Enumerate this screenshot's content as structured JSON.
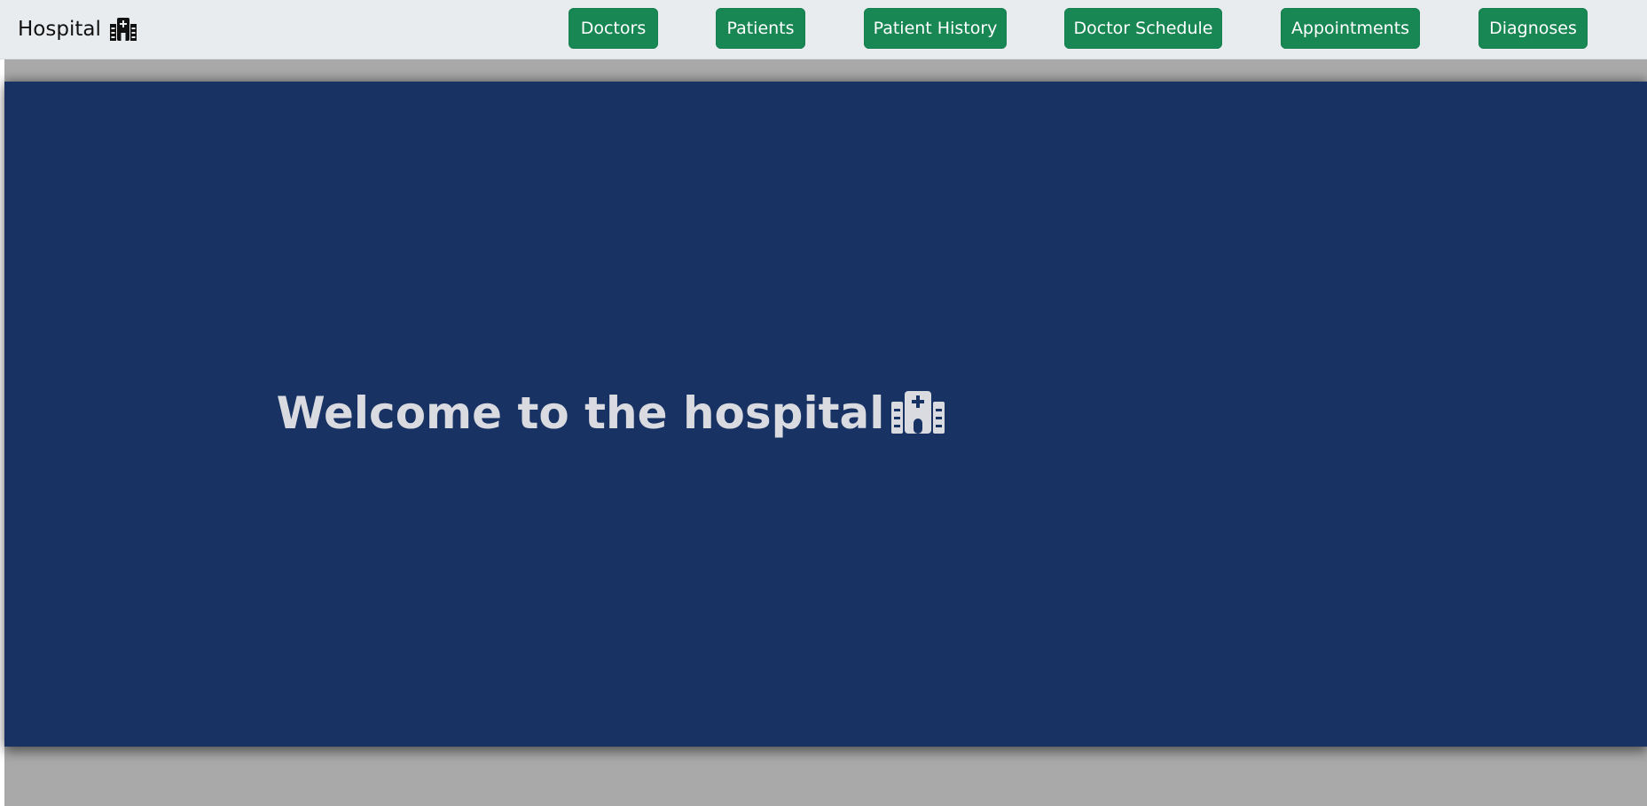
{
  "navbar": {
    "brand_label": "Hospital",
    "brand_icon": "hospital-icon",
    "items": [
      {
        "label": "Doctors"
      },
      {
        "label": "Patients"
      },
      {
        "label": "Patient History"
      },
      {
        "label": "Doctor Schedule"
      },
      {
        "label": "Appointments"
      },
      {
        "label": "Diagnoses"
      }
    ]
  },
  "hero": {
    "heading": "Welcome to the hospital",
    "icon": "hospital-icon"
  },
  "colors": {
    "navbar_bg": "#e9ecef",
    "button_green": "#198754",
    "hero_bg": "#173263",
    "page_bg": "#a9a9a9",
    "hero_text": "#d9dbe1"
  }
}
